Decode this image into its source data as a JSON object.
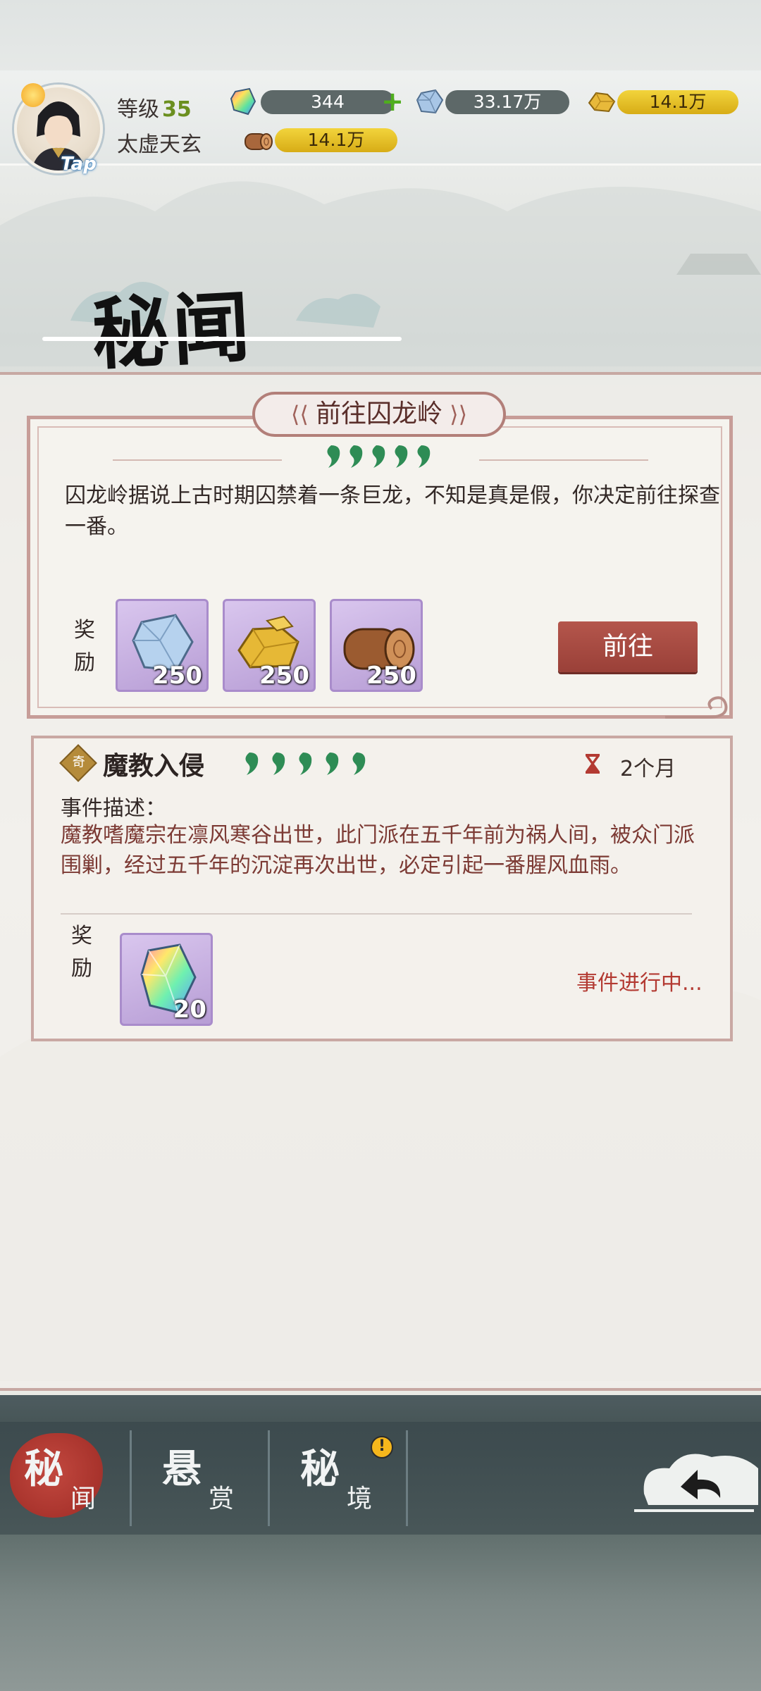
{
  "player": {
    "level_label": "等级",
    "level": "35",
    "name": "太虚天玄",
    "tap_label": "Tap"
  },
  "resources": {
    "crystal": "344",
    "ore": "33.17万",
    "gold": "14.1万",
    "wood": "14.1万"
  },
  "page": {
    "title": "秘闻"
  },
  "event1": {
    "title": "前往囚龙岭",
    "stars": "❟❟❟❟❟",
    "description": "囚龙岭据说上古时期囚禁着一条巨龙，不知是真是假，你决定前往探查一番。",
    "reward_label": "奖励",
    "rewards": [
      {
        "icon": "ore-icon",
        "count": "250"
      },
      {
        "icon": "gold-icon",
        "count": "250"
      },
      {
        "icon": "wood-icon",
        "count": "250"
      }
    ],
    "go_label": "前往"
  },
  "event2": {
    "badge": "奇",
    "title": "魔教入侵",
    "duration": "2个月",
    "description_label": "事件描述：",
    "description": "魔教嗜魔宗在凛风寒谷出世，此门派在五千年前为祸人间，被众门派围剿，经过五千年的沉淀再次出世，必定引起一番腥风血雨。",
    "reward_label": "奖励",
    "reward": {
      "icon": "crystal-icon",
      "count": "20"
    },
    "status": "事件进行中..."
  },
  "nav": {
    "tabs": [
      {
        "big": "秘",
        "small": "闻",
        "active": true
      },
      {
        "big": "悬",
        "small": "赏",
        "active": false
      },
      {
        "big": "秘",
        "small": "境",
        "active": false
      }
    ],
    "alert": "!"
  },
  "colors": {
    "accent_red": "#9a4038",
    "frame": "#c79d98",
    "star_green": "#2e8c55",
    "status_red": "#b33a32"
  }
}
